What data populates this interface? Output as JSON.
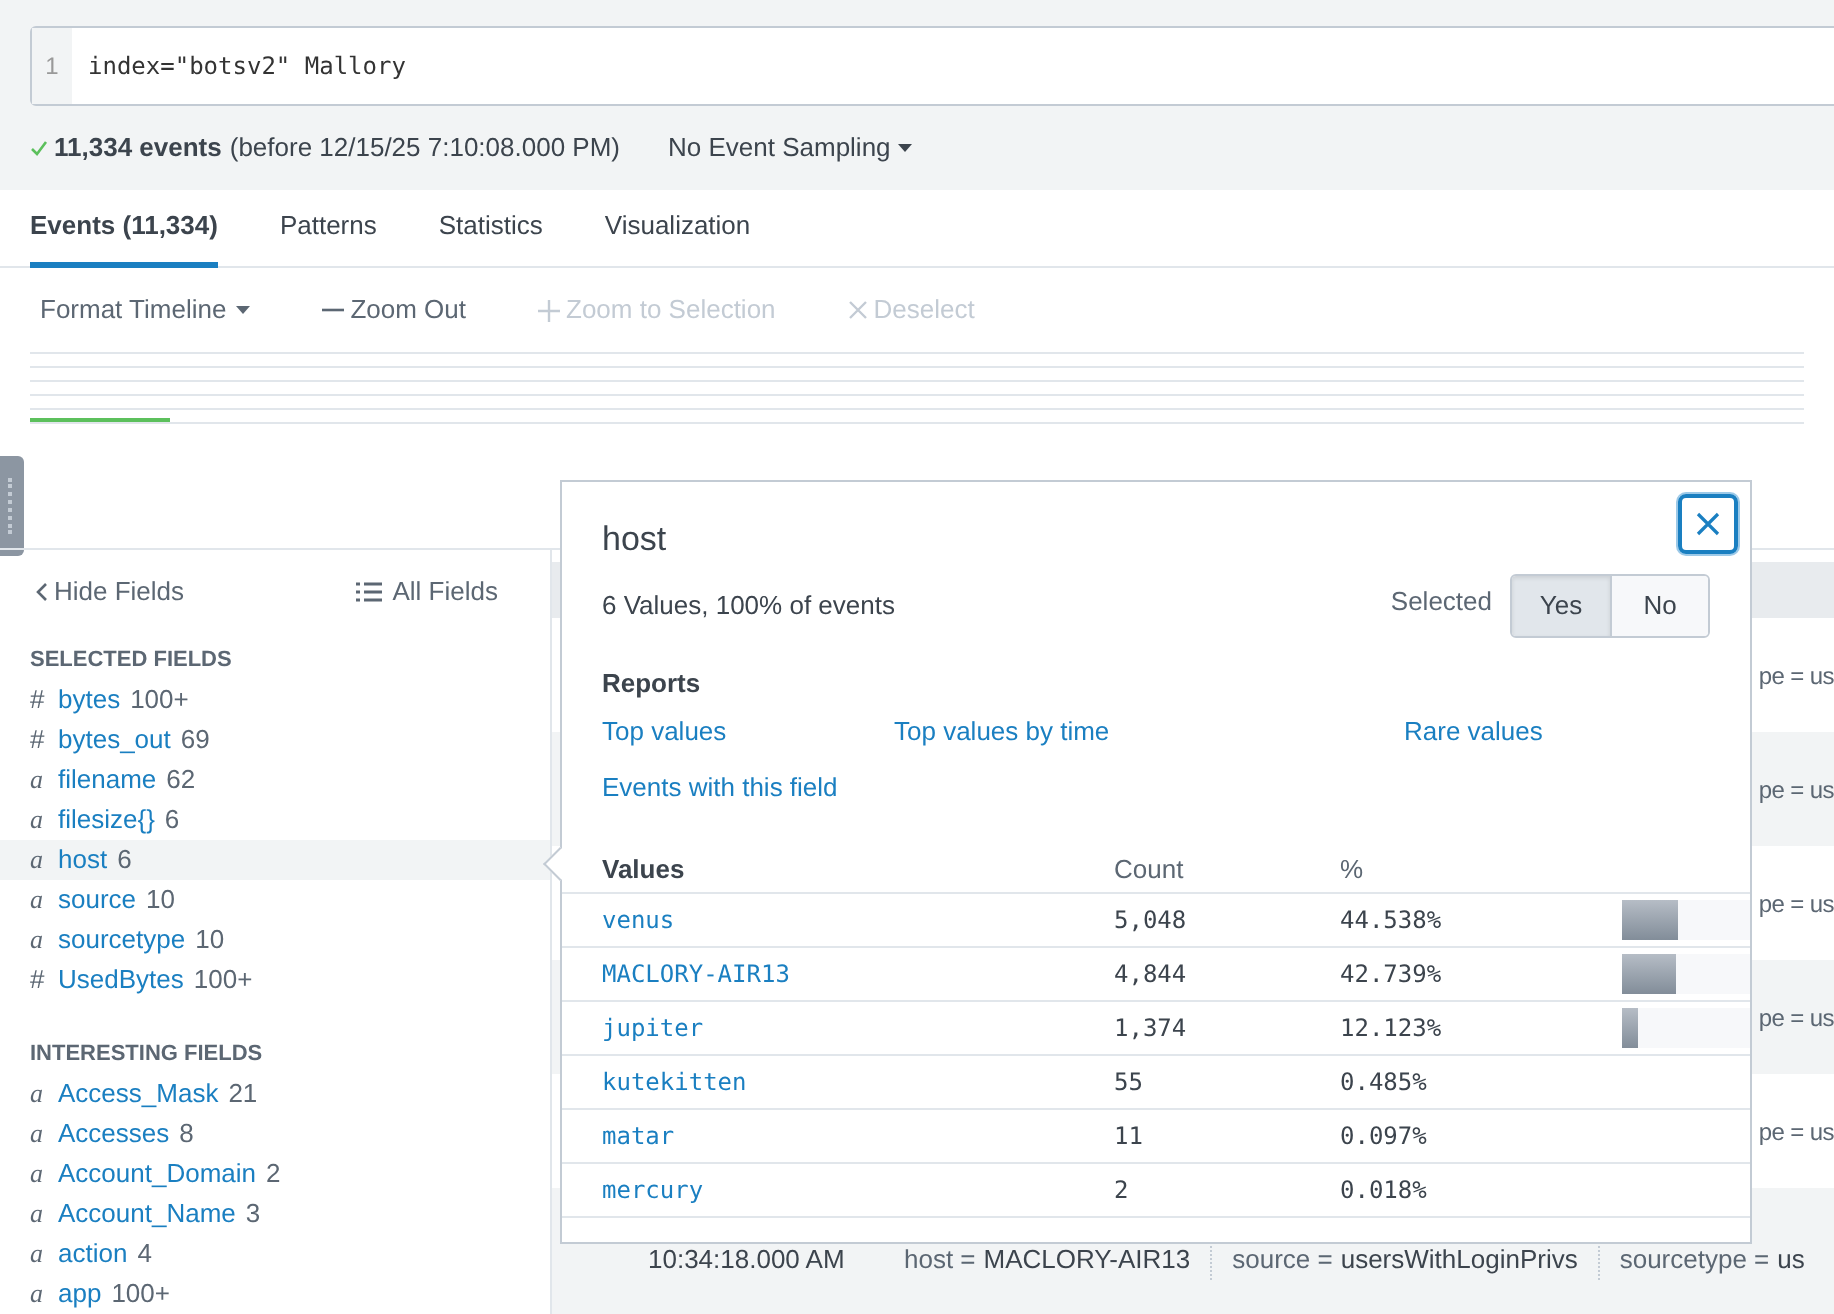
{
  "search": {
    "line_number": "1",
    "query": "index=\"botsv2\" Mallory"
  },
  "status": {
    "count": "11,334 events",
    "detail": "(before 12/15/25 7:10:08.000 PM)",
    "sampling": "No Event Sampling"
  },
  "tabs": [
    {
      "label": "Events (11,334)",
      "selected": true
    },
    {
      "label": "Patterns",
      "selected": false
    },
    {
      "label": "Statistics",
      "selected": false
    },
    {
      "label": "Visualization",
      "selected": false
    }
  ],
  "timeline_toolbar": [
    {
      "label": "Format Timeline",
      "kind": "dropdown",
      "disabled": false
    },
    {
      "label": "Zoom Out",
      "kind": "minus",
      "disabled": false
    },
    {
      "label": "Zoom to Selection",
      "kind": "plus",
      "disabled": true
    },
    {
      "label": "Deselect",
      "kind": "cross",
      "disabled": true
    }
  ],
  "sidebar": {
    "hide_label": "Hide Fields",
    "all_label": "All Fields",
    "sections": [
      {
        "title": "SELECTED FIELDS",
        "fields": [
          {
            "kind": "number",
            "type_icon": "#",
            "name": "bytes",
            "count": "100+",
            "selected": false
          },
          {
            "kind": "number",
            "type_icon": "#",
            "name": "bytes_out",
            "count": "69",
            "selected": false
          },
          {
            "kind": "string",
            "type_icon": "a",
            "name": "filename",
            "count": "62",
            "selected": false
          },
          {
            "kind": "string",
            "type_icon": "a",
            "name": "filesize{}",
            "count": "6",
            "selected": false
          },
          {
            "kind": "string",
            "type_icon": "a",
            "name": "host",
            "count": "6",
            "selected": true
          },
          {
            "kind": "string",
            "type_icon": "a",
            "name": "source",
            "count": "10",
            "selected": false
          },
          {
            "kind": "string",
            "type_icon": "a",
            "name": "sourcetype",
            "count": "10",
            "selected": false
          },
          {
            "kind": "number",
            "type_icon": "#",
            "name": "UsedBytes",
            "count": "100+",
            "selected": false
          }
        ]
      },
      {
        "title": "INTERESTING FIELDS",
        "fields": [
          {
            "kind": "string",
            "type_icon": "a",
            "name": "Access_Mask",
            "count": "21",
            "selected": false
          },
          {
            "kind": "string",
            "type_icon": "a",
            "name": "Accesses",
            "count": "8",
            "selected": false
          },
          {
            "kind": "string",
            "type_icon": "a",
            "name": "Account_Domain",
            "count": "2",
            "selected": false
          },
          {
            "kind": "string",
            "type_icon": "a",
            "name": "Account_Name",
            "count": "3",
            "selected": false
          },
          {
            "kind": "string",
            "type_icon": "a",
            "name": "action",
            "count": "4",
            "selected": false
          },
          {
            "kind": "string",
            "type_icon": "a",
            "name": "app",
            "count": "100+",
            "selected": false
          }
        ]
      }
    ]
  },
  "events": {
    "fragments": [
      "pe = us",
      "pe = us",
      "pe = us",
      "pe = us",
      "pe = us"
    ],
    "last_row": {
      "time": "10:34:18.000 AM",
      "fields": [
        {
          "key": "host =",
          "value": "MACLORY-AIR13"
        },
        {
          "key": "source =",
          "value": "usersWithLoginPrivs"
        },
        {
          "key": "sourcetype =",
          "value": "us"
        }
      ]
    }
  },
  "popup": {
    "title": "host",
    "summary": "6 Values, 100% of events",
    "selected_label": "Selected",
    "selected_options": [
      {
        "label": "Yes",
        "selected": true
      },
      {
        "label": "No",
        "selected": false
      }
    ],
    "reports_title": "Reports",
    "reports": [
      "Top values",
      "Top values by time",
      "Rare values",
      "Events with this field"
    ],
    "columns": [
      "Values",
      "Count",
      "%"
    ],
    "rows": [
      {
        "value": "venus",
        "count": "5,048",
        "percent": "44.538%",
        "level": 0.445
      },
      {
        "value": "MACLORY-AIR13",
        "count": "4,844",
        "percent": "42.739%",
        "level": 0.427
      },
      {
        "value": "jupiter",
        "count": "1,374",
        "percent": "12.123%",
        "level": 0.121
      },
      {
        "value": "kutekitten",
        "count": "55",
        "percent": "0.485%"
      },
      {
        "value": "matar",
        "count": "11",
        "percent": "0.097%"
      },
      {
        "value": "mercury",
        "count": "2",
        "percent": "0.018%"
      }
    ]
  }
}
